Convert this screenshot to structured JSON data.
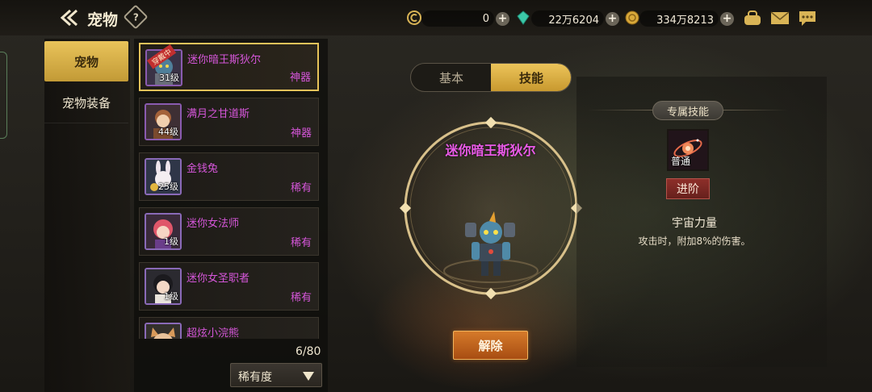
{
  "header": {
    "title": "宠物",
    "help_symbol": "?"
  },
  "currencies": [
    {
      "icon": "coin-c-icon",
      "value": "0"
    },
    {
      "icon": "gem-icon",
      "value": "22万6204"
    },
    {
      "icon": "gold-icon",
      "value": "334万8213"
    }
  ],
  "categories": [
    {
      "label": "宠物",
      "active": true
    },
    {
      "label": "宠物装备",
      "active": false
    }
  ],
  "pets": [
    {
      "name": "迷你暗王斯狄尔",
      "level": "31级",
      "rarity": "神器",
      "equipped_tag": "穿戴中",
      "selected": true
    },
    {
      "name": "满月之甘道斯",
      "level": "44级",
      "rarity": "神器"
    },
    {
      "name": "金钱兔",
      "level": "25级",
      "rarity": "稀有"
    },
    {
      "name": "迷你女法师",
      "level": "1级",
      "rarity": "稀有"
    },
    {
      "name": "迷你女圣职者",
      "level": "1级",
      "rarity": "稀有"
    },
    {
      "name": "超炫小浣熊",
      "level": "",
      "rarity": ""
    }
  ],
  "list_count": "6/80",
  "sort": {
    "label": "稀有度"
  },
  "tabs": [
    {
      "label": "基本",
      "active": false
    },
    {
      "label": "技能",
      "active": true
    }
  ],
  "selected_pet": {
    "name": "迷你暗王斯狄尔"
  },
  "skill": {
    "section_label": "专属技能",
    "type_label": "普通",
    "advance_label": "进阶",
    "name": "宇宙力量",
    "description": "攻击时，附加8%的伤害。"
  },
  "release_label": "解除",
  "colors": {
    "accent_gold": "#e9c35a",
    "rarity_purple": "#d556d9",
    "release_orange": "#c2621d"
  }
}
